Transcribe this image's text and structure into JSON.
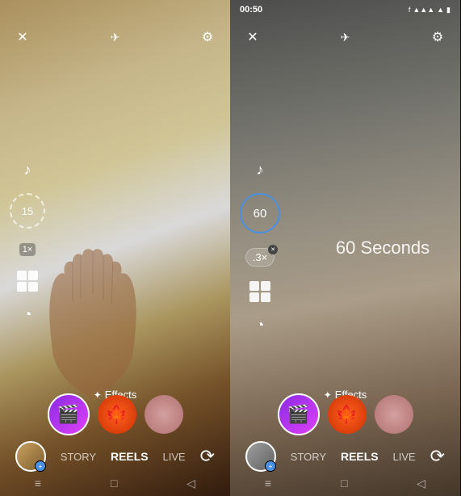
{
  "panels": [
    {
      "id": "left",
      "statusBar": {
        "show": false
      },
      "topControls": {
        "closeLabel": "✕",
        "flashLabel": "✈",
        "settingsLabel": "⚙"
      },
      "timer": {
        "value": "15",
        "type": "dashed"
      },
      "speed": "1×",
      "effectsLabel": "Effects",
      "effectsIcon": "✦",
      "effects": [
        {
          "type": "clapper",
          "active": true,
          "label": "🎬"
        },
        {
          "type": "maple",
          "active": false,
          "label": "🍁"
        },
        {
          "type": "face",
          "active": false
        }
      ],
      "nav": {
        "story": "STORY",
        "reels": "REELS",
        "live": "LIVE"
      }
    },
    {
      "id": "right",
      "statusBar": {
        "show": true,
        "time": "00:50"
      },
      "topControls": {
        "closeLabel": "✕",
        "flashLabel": "✈",
        "settingsLabel": "⚙"
      },
      "timer": {
        "value": "60",
        "type": "solid"
      },
      "speed": ".3×",
      "secondsOverlay": "60 Seconds",
      "effectsLabel": "Effects",
      "effectsIcon": "✦",
      "effects": [
        {
          "type": "clapper",
          "active": true,
          "label": "🎬"
        },
        {
          "type": "maple",
          "active": false,
          "label": "🍁"
        },
        {
          "type": "face",
          "active": false
        }
      ],
      "nav": {
        "story": "STORY",
        "reels": "REELS",
        "live": "LIVE"
      }
    }
  ]
}
